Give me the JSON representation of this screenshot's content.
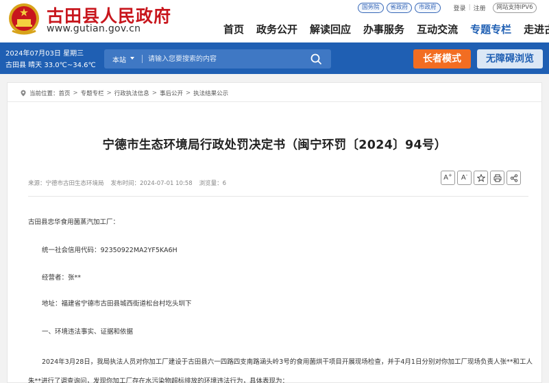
{
  "header": {
    "site_name": "古田县人民政府",
    "site_url": "www.gutian.gov.cn",
    "top_links": [
      "国务院",
      "省政府",
      "市政府"
    ],
    "login": "登录",
    "register": "注册",
    "ipv6": "网站支持IPV6",
    "colors": {
      "brand_red": "#c8161d",
      "primary_blue": "#1f5fb3"
    }
  },
  "nav": {
    "items": [
      {
        "label": "首页",
        "icon": ""
      },
      {
        "label": "政务公开"
      },
      {
        "label": "解读回应"
      },
      {
        "label": "办事服务"
      },
      {
        "label": "互动交流"
      },
      {
        "label": "专题专栏",
        "active": true
      },
      {
        "label": "走进古田"
      }
    ]
  },
  "bar": {
    "date": "2024年07月03日 星期三",
    "weather": "古田县 晴天 33.0℃~34.6℃",
    "search_scope": "本站",
    "search_placeholder": "请输入您要搜索的内容",
    "elder_mode": "长者模式",
    "accessible": "无障碍浏览",
    "colors": {
      "elder_orange": "#f26d22"
    }
  },
  "breadcrumb": {
    "prefix": "当前位置：",
    "items": [
      "首页",
      "专题专栏",
      "行政执法信息",
      "事后公开",
      "执法结果公示"
    ],
    "separator": ">"
  },
  "article": {
    "title": "宁德市生态环境局行政处罚决定书（闽宁环罚〔2024〕94号）",
    "source": "来源：宁德市古田生态环境局",
    "publish_time": "发布时间：2024-07-01 10:58",
    "views": "浏览量：6",
    "tools": [
      {
        "icon": "font-increase-icon",
        "label": "A",
        "sup": "+"
      },
      {
        "icon": "font-decrease-icon",
        "label": "A",
        "sup": "-"
      },
      {
        "icon": "star-icon"
      },
      {
        "icon": "print-icon"
      },
      {
        "icon": "share-icon"
      }
    ],
    "paragraphs": {
      "p1": "古田县忠华食用菌蒸汽加工厂：",
      "p2": "统一社会信用代码：92350922MA2YF5KA6H",
      "p3": "经营者：张**",
      "p4": "地址：福建省宁德市古田县城西街道松台村圪头圳下",
      "p5": "一、环境违法事实、证据和依据",
      "p6": "2024年3月28日，我局执法人员对你加工厂建设于古田县六一四路四支南路涵头岭3号的食用菌烘干项目开展现场检查，并于4月1日分别对你加工厂现场负责人张**和工人朱**进行了调查询问，发现你加工厂存在水污染物超标排放的环境违法行为，具体表现为："
    }
  }
}
